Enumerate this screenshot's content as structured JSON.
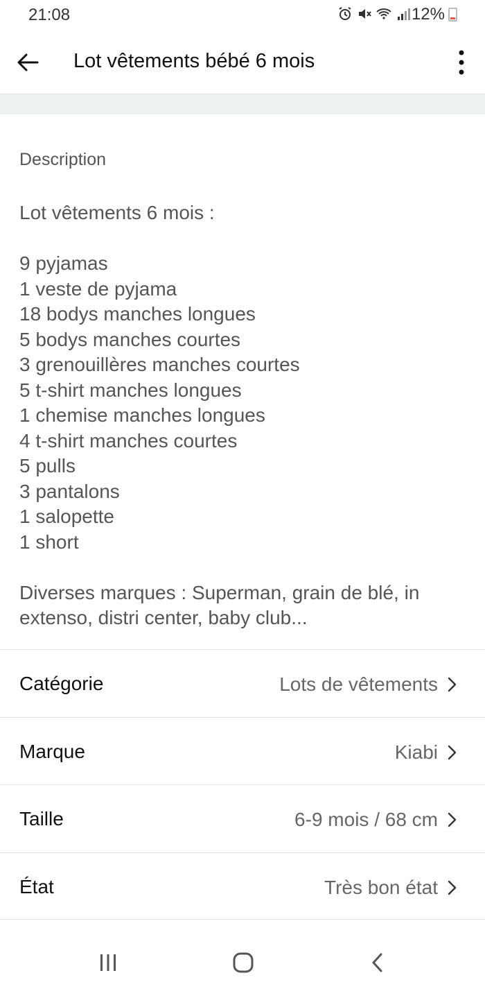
{
  "status_bar": {
    "time": "21:08",
    "battery": "12%"
  },
  "app_bar": {
    "title": "Lot vêtements bébé 6 mois"
  },
  "description": {
    "label": "Description",
    "text": "Lot vêtements 6 mois :\n\n9 pyjamas\n1 veste de pyjama\n18 bodys manches longues\n5 bodys manches courtes\n3 grenouillères manches courtes\n5 t-shirt manches longues\n1 chemise manches longues\n4 t-shirt manches courtes\n5 pulls\n3 pantalons\n1 salopette\n1 short\n\nDiverses marques : Superman, grain de blé, in extenso, distri center, baby club..."
  },
  "details": [
    {
      "label": "Catégorie",
      "value": "Lots de vêtements"
    },
    {
      "label": "Marque",
      "value": "Kiabi"
    },
    {
      "label": "Taille",
      "value": "6-9 mois / 68 cm"
    },
    {
      "label": "État",
      "value": "Très bon état"
    }
  ]
}
